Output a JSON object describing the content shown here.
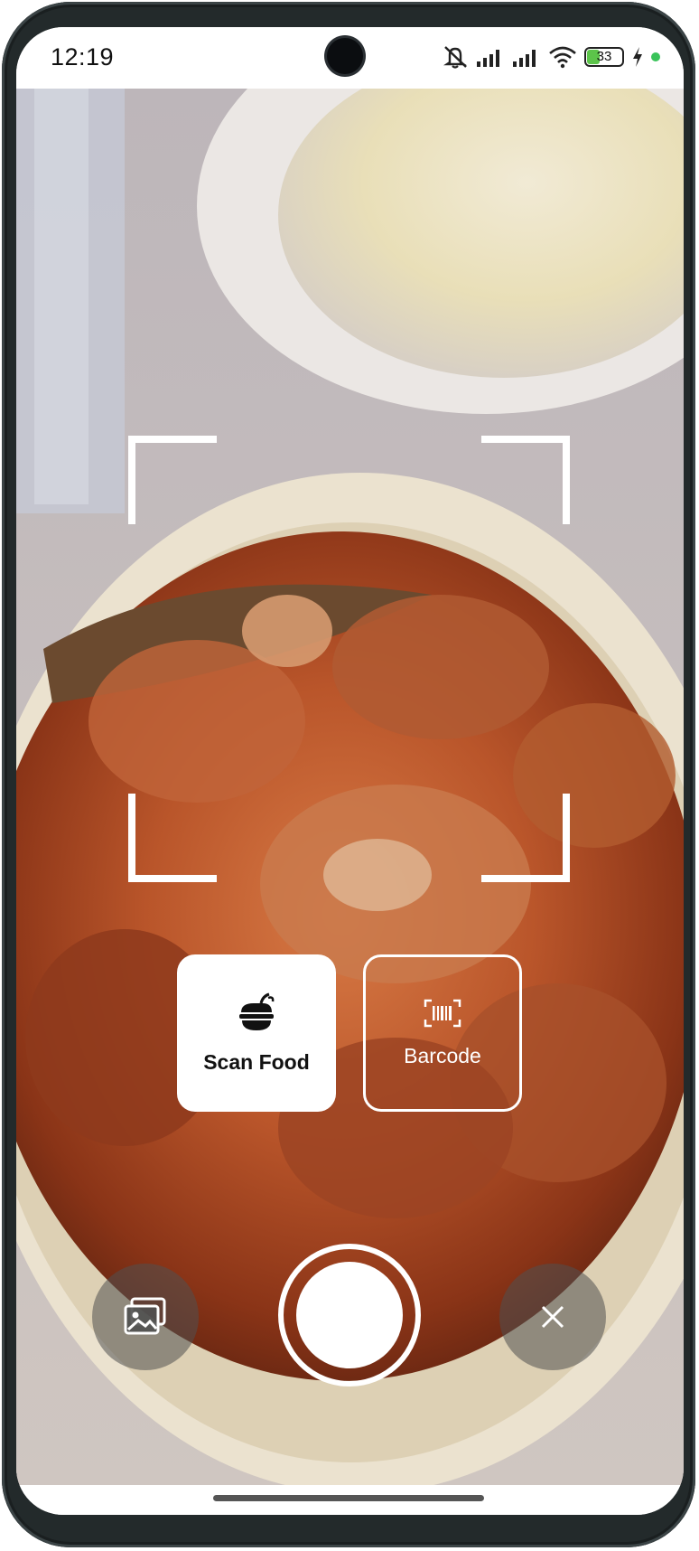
{
  "status_bar": {
    "time": "12:19",
    "battery_level": "33",
    "icons": [
      "mute-icon",
      "signal-icon",
      "signal-icon",
      "wifi-icon",
      "battery-icon",
      "charging-icon"
    ]
  },
  "camera": {
    "scene": "photo-of-braised-pork-dish-in-bowl"
  },
  "modes": {
    "scan_food": {
      "label": "Scan Food",
      "icon": "food-icon",
      "selected": true
    },
    "barcode": {
      "label": "Barcode",
      "icon": "barcode-icon",
      "selected": false
    }
  },
  "controls": {
    "gallery_icon": "gallery-icon",
    "shutter": "shutter-button",
    "close_icon": "close-icon"
  },
  "colors": {
    "overlay": "#ffffff",
    "control_bg": "#505050",
    "battery_fill": "#5cc44a"
  }
}
